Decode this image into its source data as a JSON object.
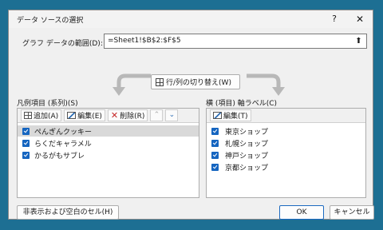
{
  "dialog": {
    "title": "データ ソースの選択",
    "help_label": "?",
    "close_label": "✕"
  },
  "range": {
    "label": "グラフ データの範囲(D):",
    "value": "=Sheet1!$B$2:$F$5",
    "collapse_icon": "collapse-dialog-icon",
    "collapse_glyph": "⬆"
  },
  "switch_button": {
    "label": "行/列の切り替え(W)",
    "icon": "switch-row-column-icon"
  },
  "legend_panel": {
    "title": "凡例項目 (系列)(S)",
    "toolbar": {
      "add_label": "追加(A)",
      "edit_label": "編集(E)",
      "remove_label": "削除(R)",
      "move_up_glyph": "⌃",
      "move_down_glyph": "⌄"
    },
    "items": [
      {
        "label": "ぺんぎんクッキー",
        "checked": true,
        "selected": true
      },
      {
        "label": "らくだキャラメル",
        "checked": true,
        "selected": false
      },
      {
        "label": "かるがもサブレ",
        "checked": true,
        "selected": false
      }
    ]
  },
  "axis_panel": {
    "title": "横 (項目) 軸ラベル(C)",
    "toolbar": {
      "edit_label": "編集(T)"
    },
    "items": [
      {
        "label": "東京ショップ",
        "checked": true
      },
      {
        "label": "札幌ショップ",
        "checked": true
      },
      {
        "label": "神戸ショップ",
        "checked": true
      },
      {
        "label": "京都ショップ",
        "checked": true
      }
    ]
  },
  "footer": {
    "hidden_cells_label": "非表示および空白のセル(H)",
    "ok_label": "OK",
    "cancel_label": "キャンセル"
  },
  "colors": {
    "checkbox": "#1565c0",
    "background": "#1d6f93"
  }
}
